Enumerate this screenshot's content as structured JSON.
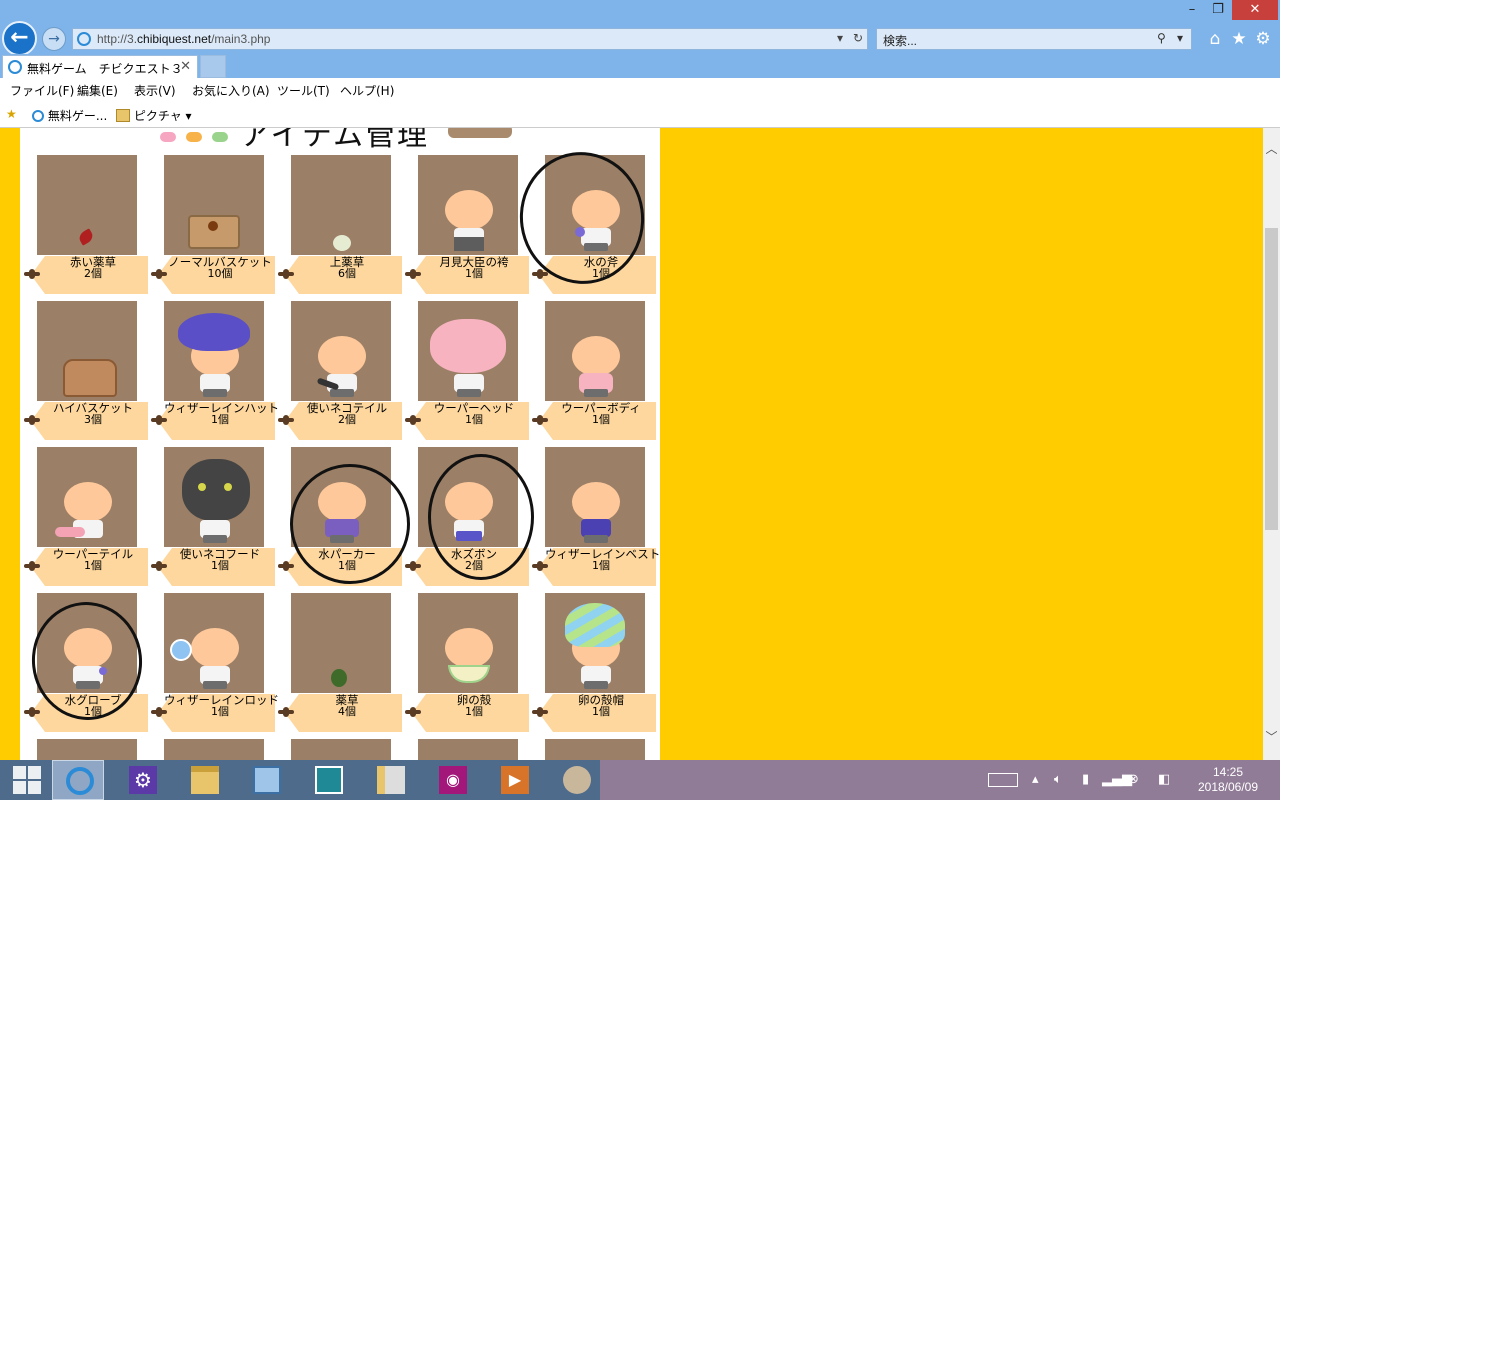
{
  "browser": {
    "window_controls": {
      "minimize": "–",
      "restore": "❐",
      "close": "✕"
    },
    "address": {
      "prefix": "http://3.",
      "domain": "chibiquest.net",
      "path": "/main3.php"
    },
    "search_placeholder": "検索...",
    "tab": {
      "title": "無料ゲーム　チビクエスト３",
      "close": "✕"
    },
    "menu": [
      "ファイル(F)",
      "編集(E)",
      "表示(V)",
      "お気に入り(A)",
      "ツール(T)",
      "ヘルプ(H)"
    ],
    "favorites": [
      "無料ゲー...",
      "ピクチャ ▾"
    ]
  },
  "page": {
    "heading": "アイテム管理",
    "items": [
      {
        "name": "赤い薬草",
        "qty": "2個"
      },
      {
        "name": "ノーマルバスケット",
        "qty": "10個"
      },
      {
        "name": "上薬草",
        "qty": "6個"
      },
      {
        "name": "月見大臣の袴",
        "qty": "1個"
      },
      {
        "name": "水の斧",
        "qty": "1個"
      },
      {
        "name": "ハイバスケット",
        "qty": "3個"
      },
      {
        "name": "ウィザーレインハット",
        "qty": "1個"
      },
      {
        "name": "使いネコテイル",
        "qty": "2個"
      },
      {
        "name": "ウーパーヘッド",
        "qty": "1個"
      },
      {
        "name": "ウーパーボディ",
        "qty": "1個"
      },
      {
        "name": "ウーパーテイル",
        "qty": "1個"
      },
      {
        "name": "使いネコフード",
        "qty": "1個"
      },
      {
        "name": "水パーカー",
        "qty": "1個"
      },
      {
        "name": "水ズボン",
        "qty": "2個"
      },
      {
        "name": "ウィザーレインベスト",
        "qty": "1個"
      },
      {
        "name": "水グローブ",
        "qty": "1個"
      },
      {
        "name": "ウィザーレインロッド",
        "qty": "1個"
      },
      {
        "name": "薬草",
        "qty": "4個"
      },
      {
        "name": "卵の殻",
        "qty": "1個"
      },
      {
        "name": "卵の殻帽",
        "qty": "1個"
      }
    ]
  },
  "taskbar": {
    "apps": [
      "windows-start",
      "internet-explorer",
      "settings",
      "file-explorer",
      "control-panel",
      "photos",
      "folder",
      "camera",
      "video",
      "paint"
    ],
    "clock": {
      "time": "14:25",
      "date": "2018/06/09"
    }
  },
  "colors": {
    "page_bg": "#ffcc00",
    "item_tile": "#9b7f66",
    "tag": "#fdd79e",
    "titlebar": "#7eb4ea"
  }
}
